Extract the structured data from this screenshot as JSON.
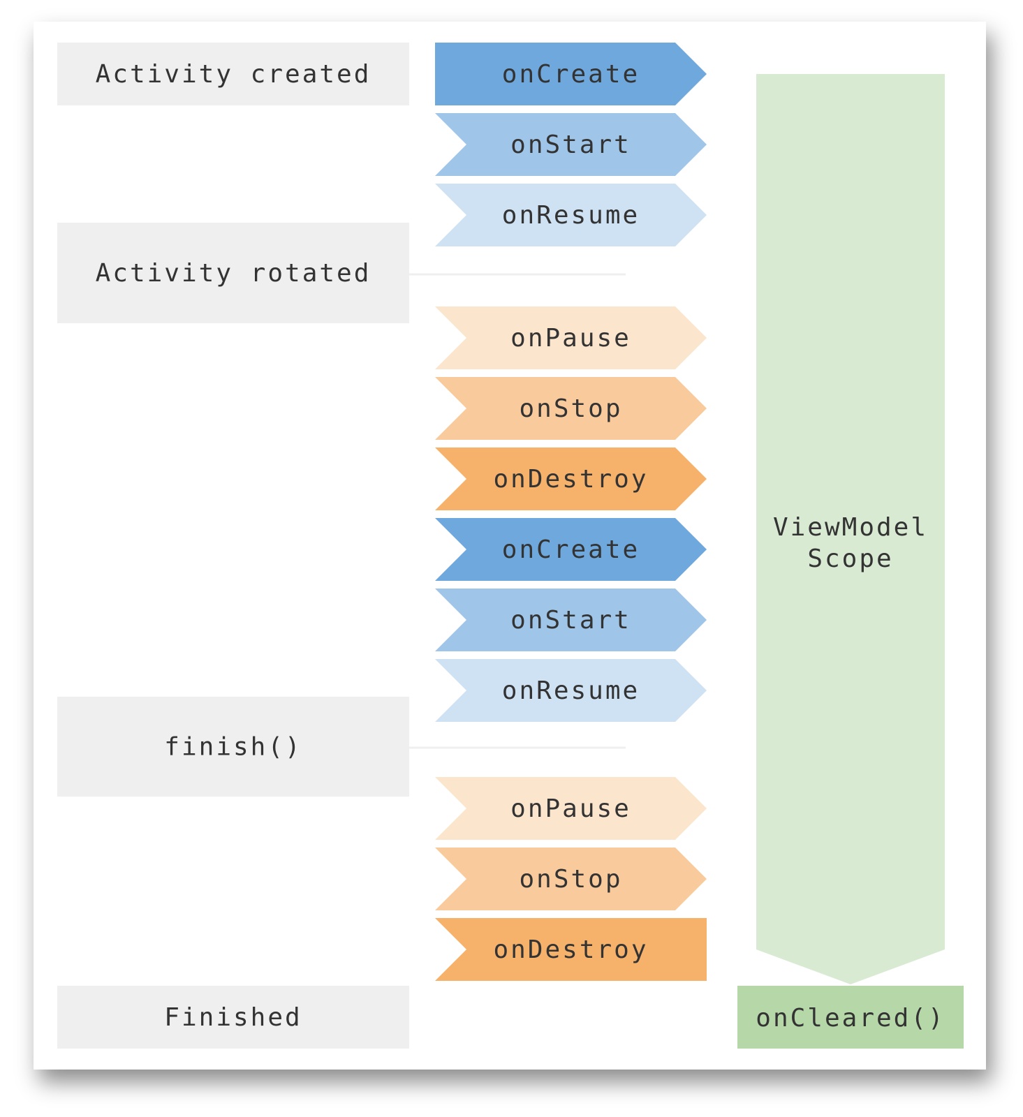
{
  "states": [
    {
      "label": "Activity created"
    },
    {
      "label": "Activity rotated"
    },
    {
      "label": "finish()"
    },
    {
      "label": "Finished"
    }
  ],
  "lifecycle": [
    {
      "label": "onCreate",
      "color": "#6fa8dc",
      "shape": "first"
    },
    {
      "label": "onStart",
      "color": "#9fc5e8",
      "shape": "chevron"
    },
    {
      "label": "onResume",
      "color": "#cfe2f3",
      "shape": "chevron"
    },
    {
      "label": "onPause",
      "color": "#fce5cd",
      "shape": "chevron"
    },
    {
      "label": "onStop",
      "color": "#f9cb9c",
      "shape": "chevron"
    },
    {
      "label": "onDestroy",
      "color": "#f6b26b",
      "shape": "chevron"
    },
    {
      "label": "onCreate",
      "color": "#6fa8dc",
      "shape": "chevron"
    },
    {
      "label": "onStart",
      "color": "#9fc5e8",
      "shape": "chevron"
    },
    {
      "label": "onResume",
      "color": "#cfe2f3",
      "shape": "chevron"
    },
    {
      "label": "onPause",
      "color": "#fce5cd",
      "shape": "chevron"
    },
    {
      "label": "onStop",
      "color": "#f9cb9c",
      "shape": "chevron"
    },
    {
      "label": "onDestroy",
      "color": "#f6b26b",
      "shape": "last"
    }
  ],
  "viewmodel": {
    "scope_line1": "ViewModel",
    "scope_line2": "Scope",
    "scope_color": "#d9ead3",
    "cleared_label": "onCleared()",
    "cleared_color": "#b6d7a8"
  },
  "state_box_color": "#efefef",
  "connector_color": "#efefef"
}
